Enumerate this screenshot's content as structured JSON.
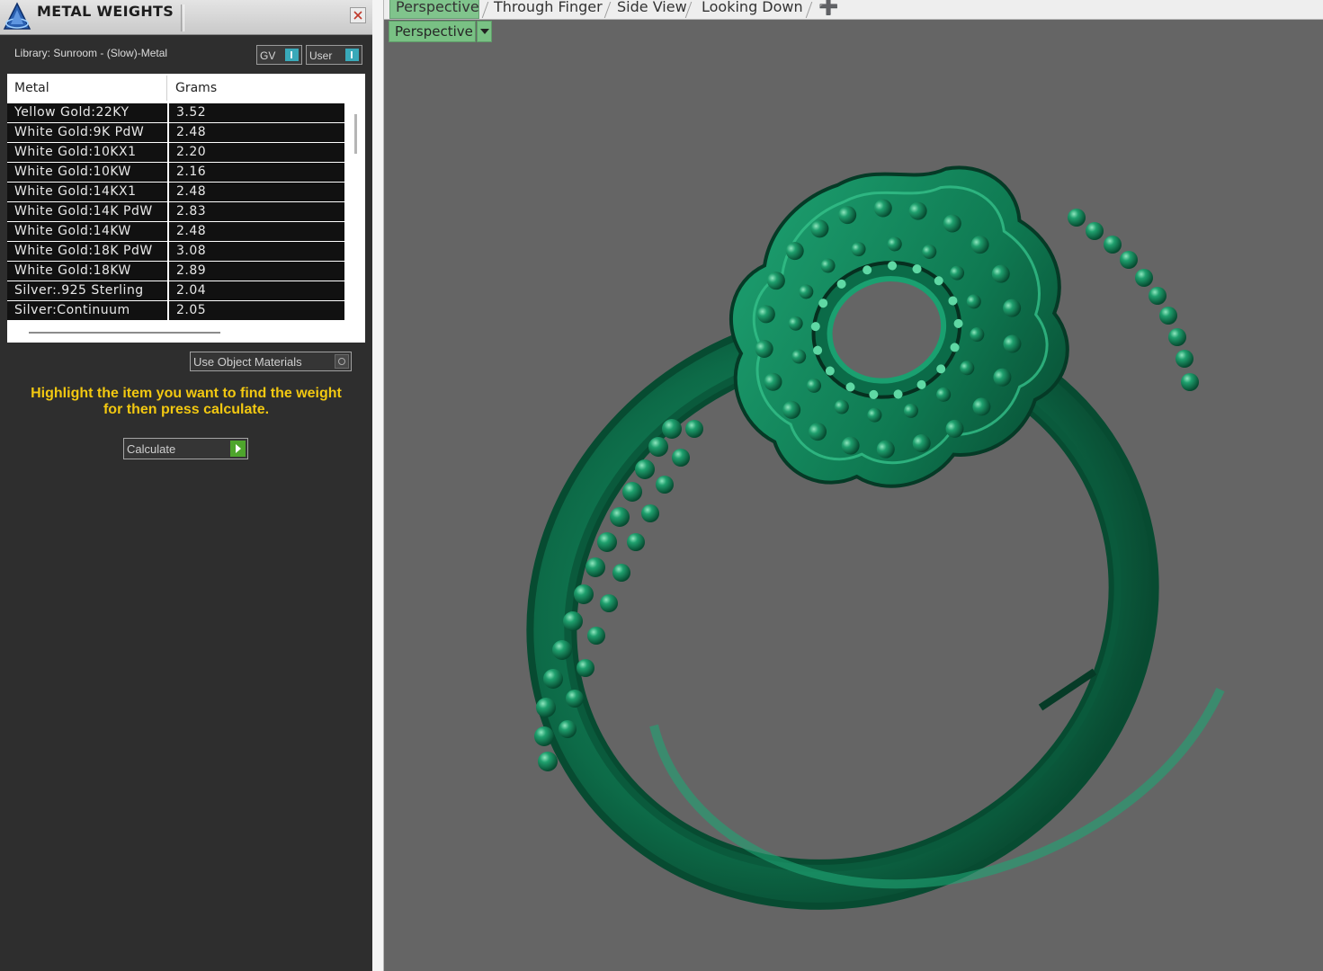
{
  "panel": {
    "title": "METAL WEIGHTS",
    "library_label": "Library: Sunroom - (Slow)-Metal",
    "toggle_gv": "GV",
    "toggle_user": "User",
    "columns": [
      "Metal",
      "Grams"
    ],
    "rows": [
      {
        "metal": "Yellow Gold:22KY",
        "grams": "3.52"
      },
      {
        "metal": "White Gold:9K PdW",
        "grams": "2.48"
      },
      {
        "metal": "White Gold:10KX1",
        "grams": "2.20"
      },
      {
        "metal": "White Gold:10KW",
        "grams": "2.16"
      },
      {
        "metal": "White Gold:14KX1",
        "grams": "2.48"
      },
      {
        "metal": "White Gold:14K PdW",
        "grams": "2.83"
      },
      {
        "metal": "White Gold:14KW",
        "grams": "2.48"
      },
      {
        "metal": "White Gold:18K PdW",
        "grams": "3.08"
      },
      {
        "metal": "White Gold:18KW",
        "grams": "2.89"
      },
      {
        "metal": "Silver:.925 Sterling",
        "grams": "2.04"
      },
      {
        "metal": "Silver:Continuum",
        "grams": "2.05"
      }
    ],
    "use_object_materials": "Use Object Materials",
    "hint_line1": "Highlight the item you want to find the weight",
    "hint_line2": "for then press calculate.",
    "calculate_label": "Calculate"
  },
  "viewport": {
    "tabs": [
      "Perspective",
      "Through Finger",
      "Side View",
      "Looking Down"
    ],
    "active_tab": "Perspective",
    "view_mode": "Perspective",
    "model_color": "#0b6b48"
  }
}
